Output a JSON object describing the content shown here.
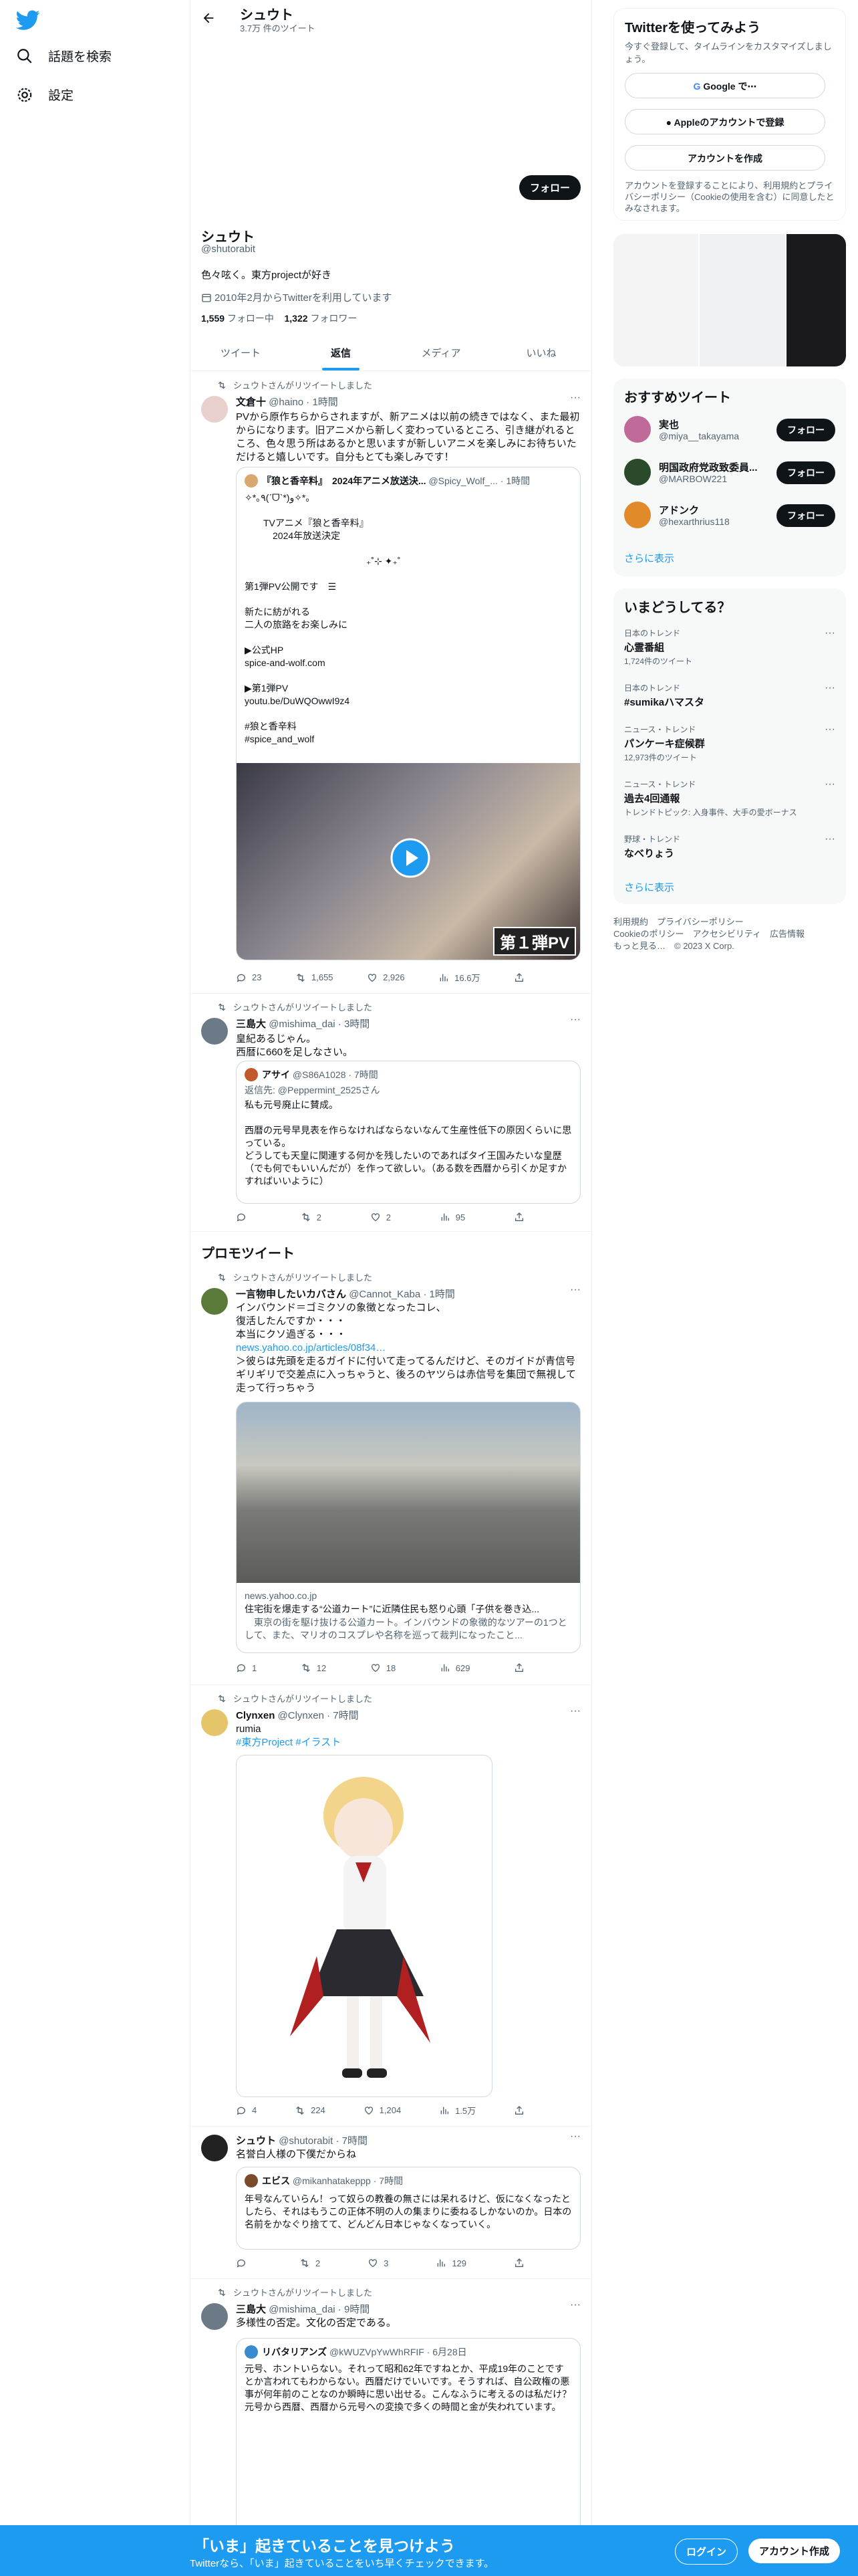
{
  "nav": {
    "explore": "話題を検索",
    "settings": "設定"
  },
  "header": {
    "name": "シュウト",
    "count": "3.7万 件のツイート"
  },
  "profile": {
    "follow": "フォロー",
    "name": "シュウト",
    "handle": "@shutorabit",
    "bio": "色々呟く。東方projectが好き",
    "joined": "2010年2月からTwitterを利用しています",
    "following_count": "1,559",
    "following_label": "フォロー中",
    "followers_count": "1,322",
    "followers_label": "フォロワー"
  },
  "tabs": [
    "ツイート",
    "返信",
    "メディア",
    "いいね"
  ],
  "t1": {
    "rt": "シュウトさんがリツイートしました",
    "name": "文倉十",
    "handle": "@haino · 1時間",
    "text": "PVから原作ちらからされますが、新アニメは以前の続きではなく、また最初からになります。旧アニメから新しく変わっているところ、引き継がれるところ、色々思う所はあるかと思いますが新しいアニメを楽しみにお待ちいただけると嬉しいです。自分もとても楽しみです！",
    "q_name": "『狼と香辛料』　2024年アニメ放送決...",
    "q_handle": "@Spicy_Wolf_... · 1時間",
    "q_text": "✧*｡٩(ˊᗜˋ*)و✧*｡\n\n　　TVアニメ『狼と香辛料』\n　　　2024年放送決定\n\n　　　　　　　　　　　　　₊˚⊹ ✦₊˚\n\n第1弾PV公開です　☰\n\n新たに紡がれる\n二人の旅路をお楽しみに\n\n▶公式HP\nspice-and-wolf.com\n\n▶第1弾PV\nyoutu.be/DuWQOwwI9z4\n\n#狼と香辛料\n#spice_and_wolf",
    "badge": "第１弾PV",
    "reply": "23",
    "retweet": "1,655",
    "like": "2,926",
    "views": "16.6万"
  },
  "t2": {
    "rt": "シュウトさんがリツイートしました",
    "name": "三島大",
    "handle": "@mishima_dai · 3時間",
    "text": "皇紀あるじゃん。\n西暦に660を足しなさい。",
    "q_name": "アサイ",
    "q_handle": "@S86A1028 · 7時間",
    "q_reply_to": "返信先: @Peppermint_2525さん",
    "q_text": "私も元号廃止に賛成。\n\n西暦の元号早見表を作らなければならないなんて生産性低下の原因くらいに思っている。\nどうしても天皇に関連する何かを残したいのであればタイ王国みたいな皇歴（でも何でもいいんだが）を作って欲しい。（ある数を西暦から引くか足すかすればいいように）",
    "reply": "",
    "retweet": "2",
    "like": "2",
    "views": "95"
  },
  "promo": "プロモツイート",
  "t3": {
    "rt": "シュウトさんがリツイートしました",
    "name": "一言物申したいカバさん",
    "handle": "@Cannot_Kaba · 1時間",
    "text": "インバウンド＝ゴミクソの象徴となったコレ、\n復活したんですか・・・\n本当にクソ過ぎる・・・",
    "link": "news.yahoo.co.jp/articles/08f34…",
    "text2": "＞彼らは先頭を走るガイドに付いて走ってるんだけど、そのガイドが青信号ギリギリで交差点に入っちゃうと、後ろのヤツらは赤信号を集団で無視して走って行っちゃう",
    "card_domain": "news.yahoo.co.jp",
    "card_title": "住宅街を爆走する“公道カート”に近隣住民も怒り心頭「子供を巻き込...",
    "card_desc": "　東京の街を駆け抜ける公道カート。インバウンドの象徴的なツアーの1つとして、また、マリオのコスプレや名称を巡って裁判になったこと...",
    "reply": "1",
    "retweet": "12",
    "like": "18",
    "views": "629"
  },
  "t4": {
    "rt": "シュウトさんがリツイートしました",
    "name": "Clynxen",
    "handle": "@Clynxen · 7時間",
    "text": "rumia",
    "tag": "#東方Project #イラスト",
    "reply": "4",
    "retweet": "224",
    "like": "1,204",
    "views": "1.5万"
  },
  "t5": {
    "name": "シュウト",
    "handle": "@shutorabit · 7時間",
    "text": "名誉白人様の下僕だからね",
    "q_name": "エビス",
    "q_handle": "@mikanhatakeppp · 7時間",
    "q_text": "年号なんていらん！って奴らの教養の無さには呆れるけど、仮になくなったとしたら、それはもうこの正体不明の人の集まりに委ねるしかないのか。日本の名前をかなぐり捨てて、どんどん日本じゃなくなっていく。",
    "reply": "",
    "retweet": "2",
    "like": "3",
    "views": "129"
  },
  "t6": {
    "rt": "シュウトさんがリツイートしました",
    "name": "三島大",
    "handle": "@mishima_dai · 9時間",
    "text": "多様性の否定。文化の否定である。",
    "q_name": "リバタリアンズ",
    "q_handle": "@kWUZVpYwWhRFIF · 6月28日",
    "q_text": "元号、ホントいらない。それって昭和62年ですねとか、平成19年のことですとか言われてもわからない。西暦だけでいいです。そうすれば、自公政権の悪事が何年前のことなのか瞬時に思い出せる。こんなふうに考えるのは私だけ？元号から西暦、西暦から元号への変換で多くの時間と金が失われています。"
  },
  "signup": {
    "title": "Twitterを使ってみよう",
    "desc": "今すぐ登録して、タイムラインをカスタマイズしましょう。",
    "google": "Google で⋯",
    "apple": "Appleのアカウントで登録",
    "create": "アカウントを作成",
    "legal": "アカウントを登録することにより、利用規約とプライバシーポリシー（Cookieの使用を含む）に同意したとみなされます。"
  },
  "who": {
    "title": "おすすめツイート",
    "items": [
      {
        "name": "実也",
        "handle": "@miya__takayama"
      },
      {
        "name": "明国政府党政致委員...",
        "handle": "@MARBOW221"
      },
      {
        "name": "アドンク",
        "handle": "@hexarthrius118"
      }
    ],
    "follow": "フォロー",
    "more": "さらに表示"
  },
  "trends": {
    "title": "いまどうしてる？",
    "items": [
      {
        "cat": "日本のトレンド",
        "name": "心霊番組",
        "count": "1,724件のツイート"
      },
      {
        "cat": "日本のトレンド",
        "name": "#sumikaハマスタ",
        "count": ""
      },
      {
        "cat": "ニュース・トレンド",
        "name": "パンケーキ症候群",
        "count": "12,973件のツイート"
      },
      {
        "cat": "ニュース・トレンド",
        "name": "過去4回通報",
        "count": "トレンドトピック: 入身事件、大手の愛ボーナス"
      },
      {
        "cat": "野球・トレンド",
        "name": "なべりょう",
        "count": ""
      }
    ],
    "more": "さらに表示"
  },
  "footer": "利用規約　プライバシーポリシー\nCookieのポリシー　アクセシビリティ　広告情報\nもっと見る…　© 2023 X Corp.",
  "bottom": {
    "title": "「いま」起きていることを見つけよう",
    "sub": "Twitterなら、「いま」起きていることをいち早くチェックできます。",
    "login": "ログイン",
    "signup": "アカウント作成"
  },
  "colors": {
    "accent": "#1d9bf0",
    "text": "#0f1419",
    "muted": "#536471"
  }
}
